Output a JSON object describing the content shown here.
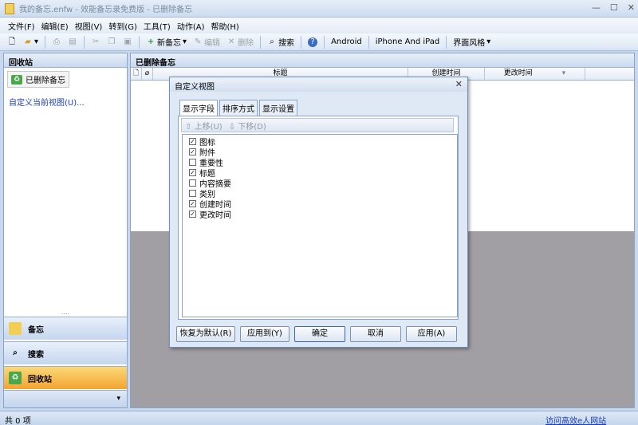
{
  "window": {
    "title": "我的备忘.enfw - 效能备忘录免费版 - 已删除备忘"
  },
  "menu": [
    "文件(F)",
    "编辑(E)",
    "视图(V)",
    "转到(G)",
    "工具(T)",
    "动作(A)",
    "帮助(H)"
  ],
  "toolbar": {
    "new_memo": "新备忘",
    "edit": "编辑",
    "delete": "删除",
    "search": "搜索",
    "android": "Android",
    "iphone": "iPhone And iPad",
    "theme": "界面风格"
  },
  "left_panel": {
    "header": "回收站",
    "tree_node": "已删除备忘",
    "customize_link": "自定义当前视图(U)...",
    "nav": [
      {
        "label": "备忘",
        "icon": "note-icon"
      },
      {
        "label": "搜索",
        "icon": "search-icon"
      },
      {
        "label": "回收站",
        "icon": "recycle-icon"
      }
    ],
    "grip": "....",
    "footer_arrow": "▾"
  },
  "right_panel": {
    "header": "已删除备忘",
    "columns": [
      "标题",
      "创建时间",
      "更改时间"
    ]
  },
  "dialog": {
    "title": "自定义视图",
    "tabs": [
      "显示字段",
      "排序方式",
      "显示设置"
    ],
    "move_up": "上移(U)",
    "move_down": "下移(D)",
    "fields": [
      {
        "label": "图标",
        "checked": true
      },
      {
        "label": "附件",
        "checked": true
      },
      {
        "label": "重要性",
        "checked": false
      },
      {
        "label": "标题",
        "checked": true
      },
      {
        "label": "内容摘要",
        "checked": false
      },
      {
        "label": "类别",
        "checked": false
      },
      {
        "label": "创建时间",
        "checked": true
      },
      {
        "label": "更改时间",
        "checked": true
      }
    ],
    "buttons": {
      "restore": "恢复为默认(R)",
      "apply_to": "应用到(Y)",
      "ok": "确定",
      "cancel": "取消",
      "apply": "应用(A)"
    }
  },
  "status": {
    "count": "共 0 项",
    "link": "访问高效e人网站"
  }
}
